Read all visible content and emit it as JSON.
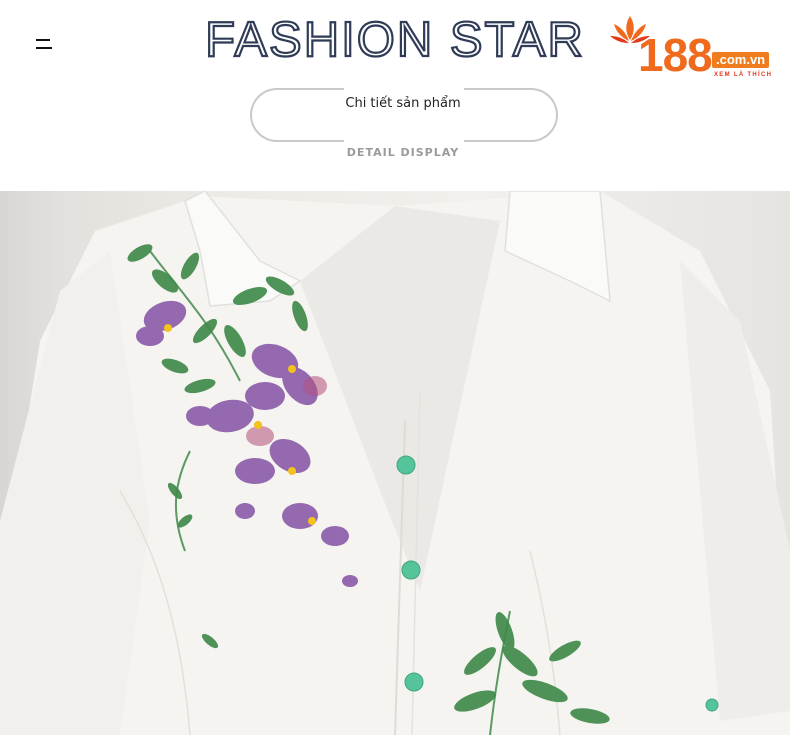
{
  "header": {
    "menu_icon": "hamburger-menu-icon",
    "brand_title": "FASHION STAR",
    "logo": {
      "number": "188",
      "domain": ".com.vn",
      "tagline": "XEM LÀ THÍCH",
      "icon": "lotus-logo-icon",
      "colors": {
        "orange": "#f06a1e",
        "red": "#e23a1c"
      }
    }
  },
  "section": {
    "title": "Chi tiết sản phẩm",
    "subtitle": "DETAIL DISPLAY"
  },
  "product_image": {
    "description_icon": "white-floral-shirt-photo",
    "colors": {
      "shirt": "#f4f3f0",
      "leaf": "#3f8a4a",
      "flower": "#8a5aa8",
      "button": "#55c49a"
    }
  }
}
